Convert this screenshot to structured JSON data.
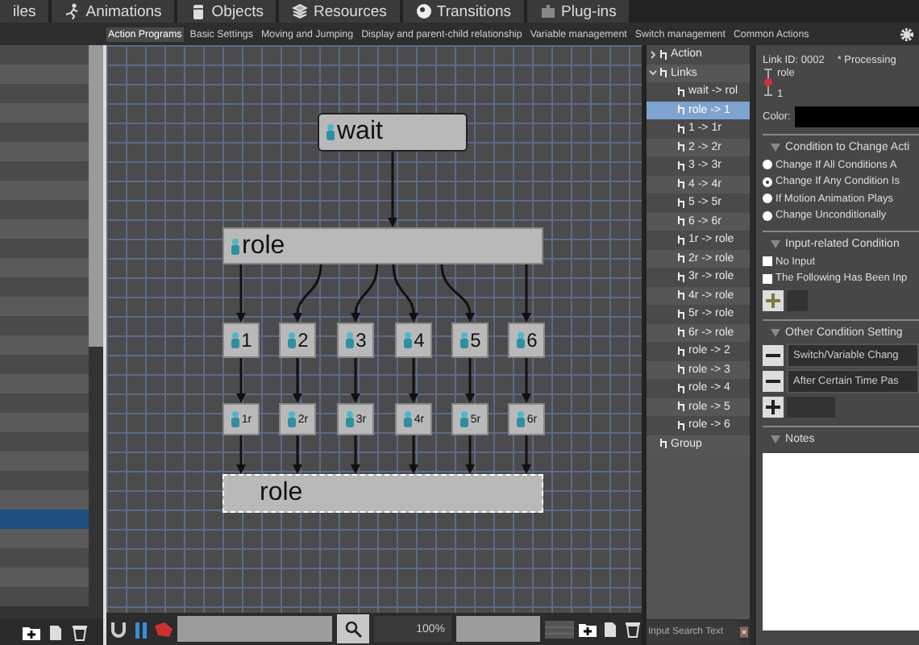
{
  "main_tabs": [
    {
      "label": "iles"
    },
    {
      "label": "Animations"
    },
    {
      "label": "Objects"
    },
    {
      "label": "Resources"
    },
    {
      "label": "Transitions"
    },
    {
      "label": "Plug-ins"
    }
  ],
  "sub_tabs": [
    {
      "label": "Action Programs",
      "selected": true
    },
    {
      "label": "Basic Settings",
      "selected": false
    },
    {
      "label": "Moving and Jumping",
      "selected": false
    },
    {
      "label": "Display and parent-child relationship",
      "selected": false
    },
    {
      "label": "Variable management",
      "selected": false
    },
    {
      "label": "Switch management",
      "selected": false
    },
    {
      "label": "Common Actions",
      "selected": false
    }
  ],
  "object_list": {
    "rows": [
      {
        "selected": false
      },
      {
        "selected": false
      },
      {
        "selected": false
      },
      {
        "selected": false
      },
      {
        "selected": false
      },
      {
        "selected": false
      },
      {
        "selected": false
      },
      {
        "selected": false
      },
      {
        "selected": false
      },
      {
        "selected": false
      },
      {
        "selected": false
      },
      {
        "selected": false
      },
      {
        "selected": false
      },
      {
        "selected": false
      },
      {
        "selected": false
      },
      {
        "selected": false
      },
      {
        "selected": false
      },
      {
        "selected": false
      },
      {
        "selected": false
      },
      {
        "selected": false
      },
      {
        "selected": false
      },
      {
        "selected": false
      },
      {
        "selected": false
      },
      {
        "selected": false
      },
      {
        "selected": true
      },
      {
        "selected": false
      },
      {
        "selected": false
      },
      {
        "selected": false
      },
      {
        "selected": false
      }
    ]
  },
  "canvas": {
    "nodes": [
      {
        "label": "wait",
        "kind": "start",
        "selected": false
      },
      {
        "label": "role",
        "kind": "group",
        "selected": false
      },
      {
        "label": "1",
        "kind": "action",
        "selected": false
      },
      {
        "label": "2",
        "kind": "action",
        "selected": false
      },
      {
        "label": "3",
        "kind": "action",
        "selected": false
      },
      {
        "label": "4",
        "kind": "action",
        "selected": false
      },
      {
        "label": "5",
        "kind": "action",
        "selected": false
      },
      {
        "label": "6",
        "kind": "action",
        "selected": false
      },
      {
        "label": "1r",
        "kind": "sub_action",
        "selected": false
      },
      {
        "label": "2r",
        "kind": "sub_action",
        "selected": false
      },
      {
        "label": "3r",
        "kind": "sub_action",
        "selected": false
      },
      {
        "label": "4r",
        "kind": "sub_action",
        "selected": false
      },
      {
        "label": "5r",
        "kind": "sub_action",
        "selected": false
      },
      {
        "label": "6r",
        "kind": "sub_action",
        "selected": false
      },
      {
        "label": "role",
        "kind": "group_end",
        "selected": true
      }
    ],
    "zoom": "100%"
  },
  "tree": {
    "items": [
      {
        "label": "Action",
        "expanded": false
      },
      {
        "label": "Links",
        "expanded": true,
        "children": [
          {
            "label": "wait -> rol",
            "selected": false
          },
          {
            "label": "role -> 1",
            "selected": true
          },
          {
            "label": "1 -> 1r",
            "selected": false
          },
          {
            "label": "2 -> 2r",
            "selected": false
          },
          {
            "label": "3 -> 3r",
            "selected": false
          },
          {
            "label": "4 -> 4r",
            "selected": false
          },
          {
            "label": "5 -> 5r",
            "selected": false
          },
          {
            "label": "6 -> 6r",
            "selected": false
          },
          {
            "label": "1r -> role",
            "selected": false
          },
          {
            "label": "2r -> role",
            "selected": false
          },
          {
            "label": "3r -> role",
            "selected": false
          },
          {
            "label": "4r -> role",
            "selected": false
          },
          {
            "label": "5r -> role",
            "selected": false
          },
          {
            "label": "6r -> role",
            "selected": false
          },
          {
            "label": "role -> 2",
            "selected": false
          },
          {
            "label": "role -> 3",
            "selected": false
          },
          {
            "label": "role -> 4",
            "selected": false
          },
          {
            "label": "role -> 5",
            "selected": false
          },
          {
            "label": "role -> 6",
            "selected": false
          }
        ]
      },
      {
        "label": "Group"
      }
    ],
    "search": {
      "placeholder": "Input Search Text"
    }
  },
  "properties": {
    "link_id": "Link ID: 0002",
    "status": "* Processing",
    "from": "role",
    "to": "1",
    "color_label": "Color:",
    "change_condition": {
      "title": "Condition to Change Acti",
      "options": [
        {
          "label": "Change If All Conditions A",
          "selected": false
        },
        {
          "label": "Change If Any Condition Is",
          "selected": true
        },
        {
          "label": "If Motion Animation Plays",
          "selected": false
        },
        {
          "label": "Change Unconditionally",
          "selected": false
        }
      ]
    },
    "input_condition": {
      "title": "Input-related Condition",
      "options": [
        {
          "label": "No Input",
          "checked": false
        },
        {
          "label": "The Following Has Been Inp",
          "checked": false
        }
      ]
    },
    "other_conditions": {
      "title": "Other Condition Setting",
      "rows": [
        "Switch/Variable Chang",
        "After Certain Time Pas"
      ]
    },
    "notes": {
      "title": "Notes"
    }
  }
}
